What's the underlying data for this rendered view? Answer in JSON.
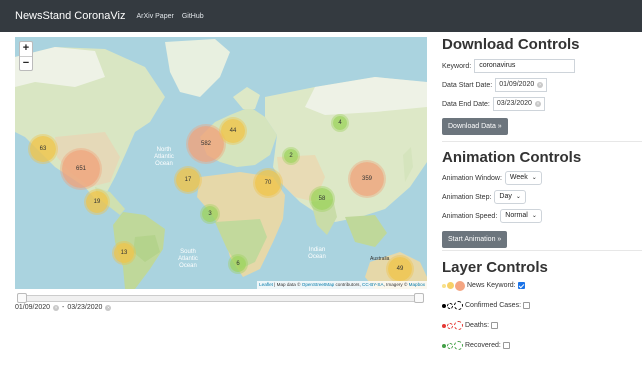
{
  "navbar": {
    "brand": "NewsStand CoronaViz",
    "links": [
      "ArXiv Paper",
      "GitHub"
    ]
  },
  "map": {
    "zoom_in": "+",
    "zoom_out": "−",
    "labels": {
      "north_atlantic": "North\nAtlantic\nOcean",
      "south_atlantic": "South\nAtlantic\nOcean",
      "indian": "Indian\nOcean",
      "australia": "Australia"
    },
    "attribution": {
      "leaflet": "Leaflet",
      "text1": " | Map data © ",
      "osm": "OpenStreetMap",
      "text2": " contributors, ",
      "license": "CC-BY-SA",
      "text3": ", Imagery © ",
      "mapbox": "Mapbox"
    },
    "clusters": [
      {
        "count": "63",
        "color": "#f0c449"
      },
      {
        "count": "651",
        "color": "#f0a27a"
      },
      {
        "count": "19",
        "color": "#f0c449"
      },
      {
        "count": "13",
        "color": "#f0c449"
      },
      {
        "count": "582",
        "color": "#f0a27a"
      },
      {
        "count": "44",
        "color": "#f0c449"
      },
      {
        "count": "17",
        "color": "#f0c449"
      },
      {
        "count": "70",
        "color": "#f0c449"
      },
      {
        "count": "2",
        "color": "#9ed35c"
      },
      {
        "count": "3",
        "color": "#9ed35c"
      },
      {
        "count": "58",
        "color": "#9ed35c"
      },
      {
        "count": "4",
        "color": "#9ed35c"
      },
      {
        "count": "359",
        "color": "#f0a27a"
      },
      {
        "count": "6",
        "color": "#9ed35c"
      },
      {
        "count": "49",
        "color": "#f0c449"
      }
    ]
  },
  "timeline": {
    "start": "01/09/2020",
    "separator": "-",
    "end": "03/23/2020"
  },
  "download": {
    "title": "Download Controls",
    "keyword_label": "Keyword:",
    "keyword_value": "coronavirus",
    "start_label": "Data Start Date:",
    "start_value": "01/09/2020",
    "end_label": "Data End Date:",
    "end_value": "03/23/2020",
    "button": "Download Data »"
  },
  "animation": {
    "title": "Animation Controls",
    "window_label": "Animation Window:",
    "window_value": "Week",
    "step_label": "Animation Step:",
    "step_value": "Day",
    "speed_label": "Animation Speed:",
    "speed_value": "Normal",
    "button": "Start Animation »"
  },
  "layers": {
    "title": "Layer Controls",
    "items": [
      {
        "label": "News Keyword:",
        "checked": true,
        "color": "#f4a582"
      },
      {
        "label": "Confirmed Cases:",
        "checked": false,
        "color": "#000000"
      },
      {
        "label": "Deaths:",
        "checked": false,
        "color": "#e53935"
      },
      {
        "label": "Recovered:",
        "checked": false,
        "color": "#43a047"
      }
    ]
  }
}
